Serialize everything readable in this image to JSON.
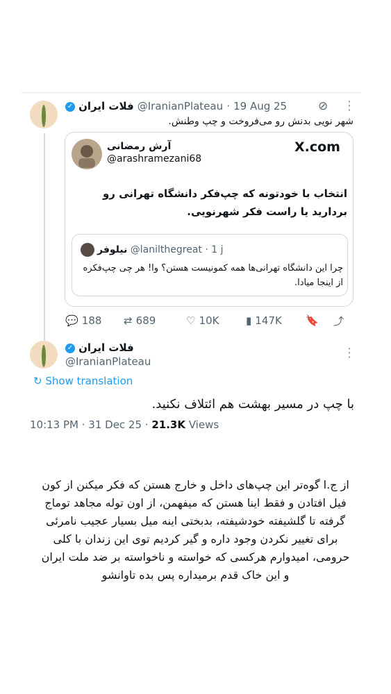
{
  "quoted_tweet": {
    "display_name": "فلات ایران",
    "handle": "@IranianPlateau",
    "date": "19 Aug 25",
    "text": "شهر نویی بدنش رو می‌فروخت و چپ وطنش.",
    "more_icon": "more-dots-icon",
    "grok_icon": "no-entry-circle-icon",
    "embedded_card": {
      "author_name": "آرش رمضانی",
      "author_handle": "@arashramezani68",
      "brand": "X.com",
      "text": "انتخاب با خودتونه که چپ‌فکر دانشگاه تهرانی رو بردارید یا راست فکر شهرنویی.",
      "nested": {
        "author_name": "نیلوفر",
        "author_handle": "@lanilthegreat",
        "time": "1 j",
        "text": "چرا این دانشگاه تهرانی‌ها همه کمونیست هستن؟ وا! هر چی چپ‌فکره از اینجا میادا."
      }
    },
    "stats": {
      "replies": "188",
      "retweets": "689",
      "likes": "10K",
      "views": "147K"
    }
  },
  "main_tweet": {
    "display_name": "فلات ایران",
    "handle": "@IranianPlateau",
    "show_translation": "Show translation",
    "text": "با چپ در مسیر بهشت هم ائتلاف نکنید.",
    "time": "10:13 PM · 31 Dec 25 · ",
    "views_count": "21.3K",
    "views_label": " Views"
  },
  "caption": "از ج.ا گوه‌تر این چپ‌های داخل و خارج هستن که فکر میکنن از کون فیل افتادن و فقط اینا هستن که میفهمن، از اون توله مجاهد توماج گرفته تا گلشیفته خودشیفته، بدبختی اینه میل بسیار عجیب نامرئی برای تغییر نکردن وجود داره و گیر کردیم توی این زندان با کلی حرومی، امیدوارم هرکسی که خواسته و ناخواسته بر ضد ملت ایران و این خاک قدم برمیداره پس بده تاوانشو",
  "colors": {
    "link": "#1d9bf0",
    "muted": "#536471",
    "border": "#cfd9de",
    "avatar_bg": "#f2dcc0"
  }
}
